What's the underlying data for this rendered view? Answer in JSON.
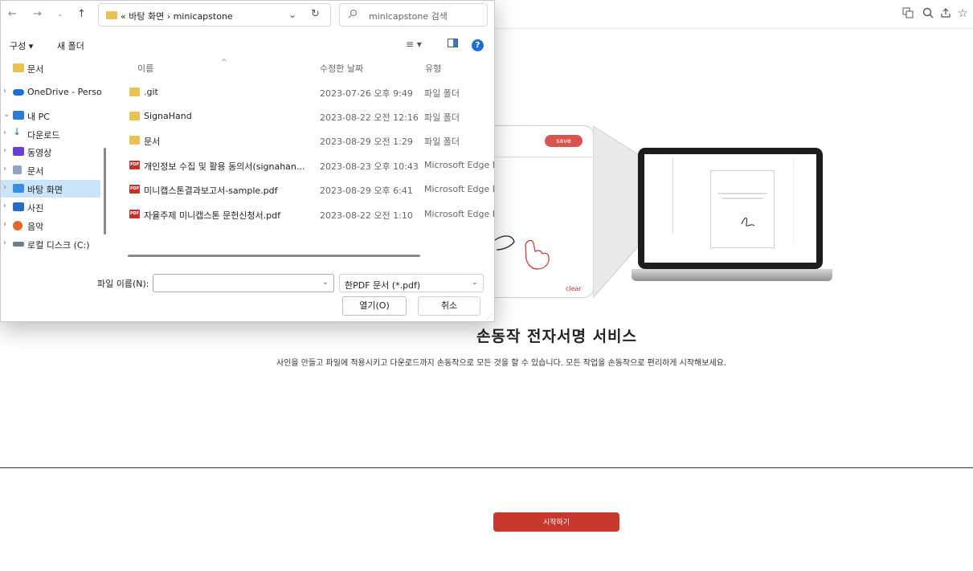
{
  "browser": {
    "icons": [
      "translate-icon",
      "zoom-icon",
      "share-icon",
      "bookmark-star-icon"
    ]
  },
  "page": {
    "save_label": "save",
    "clear_label": "clear",
    "title": "손동작 전자서명 서비스",
    "description": "사인을 만들고 파일에 적용시키고 다운로드까지 손동작으로 모든 것을 할 수 있습니다. 모든 작업을 손동작으로 편리하게 시작해보세요.",
    "start_button": "시작하기",
    "accent_color": "#c9382f"
  },
  "dialog": {
    "address": "« 바탕 화면 › minicapstone",
    "search_placeholder": "minicapstone 검색",
    "organize_label": "구성 ▾",
    "new_folder_label": "새 폴더",
    "nav_items": [
      {
        "label": "문서",
        "icon": "folder-icon",
        "chevron": "",
        "selected": false
      },
      {
        "label": "OneDrive - Perso",
        "icon": "onedrive-icon",
        "chevron": "›",
        "selected": false
      },
      {
        "label": "내 PC",
        "icon": "pc-icon",
        "chevron": "⌄",
        "selected": false
      },
      {
        "label": "다운로드",
        "icon": "download-icon",
        "chevron": "›",
        "selected": false
      },
      {
        "label": "동영상",
        "icon": "video-icon",
        "chevron": "›",
        "selected": false
      },
      {
        "label": "문서",
        "icon": "document-icon",
        "chevron": "›",
        "selected": false
      },
      {
        "label": "바탕 화면",
        "icon": "desktop-icon",
        "chevron": "›",
        "selected": true
      },
      {
        "label": "사진",
        "icon": "picture-icon",
        "chevron": "›",
        "selected": false
      },
      {
        "label": "음악",
        "icon": "music-icon",
        "chevron": "›",
        "selected": false
      },
      {
        "label": "로컬 디스크 (C:)",
        "icon": "disk-icon",
        "chevron": "›",
        "selected": false
      }
    ],
    "columns": {
      "name": "이름",
      "date": "수정한 날짜",
      "type": "유형"
    },
    "files": [
      {
        "name": ".git",
        "date": "2023-07-26 오후 9:49",
        "type": "파일 폴더",
        "kind": "folder"
      },
      {
        "name": "SignaHand",
        "date": "2023-08-22 오전 12:16",
        "type": "파일 폴더",
        "kind": "folder"
      },
      {
        "name": "문서",
        "date": "2023-08-29 오전 1:29",
        "type": "파일 폴더",
        "kind": "folder"
      },
      {
        "name": "개인정보 수집 및 활용 동의서(signahan...",
        "date": "2023-08-23 오후 10:43",
        "type": "Microsoft Edge P",
        "kind": "pdf"
      },
      {
        "name": "미니캡스톤결과보고서-sample.pdf",
        "date": "2023-08-29 오후 6:41",
        "type": "Microsoft Edge P",
        "kind": "pdf"
      },
      {
        "name": "자율주제 미니캡스톤 문헌신청서.pdf",
        "date": "2023-08-22 오전 1:10",
        "type": "Microsoft Edge P",
        "kind": "pdf"
      }
    ],
    "filename_label": "파일 이름(N):",
    "filename_value": "",
    "filetype_value": "한PDF 문서 (*.pdf)",
    "open_label": "열기(O)",
    "cancel_label": "취소"
  }
}
